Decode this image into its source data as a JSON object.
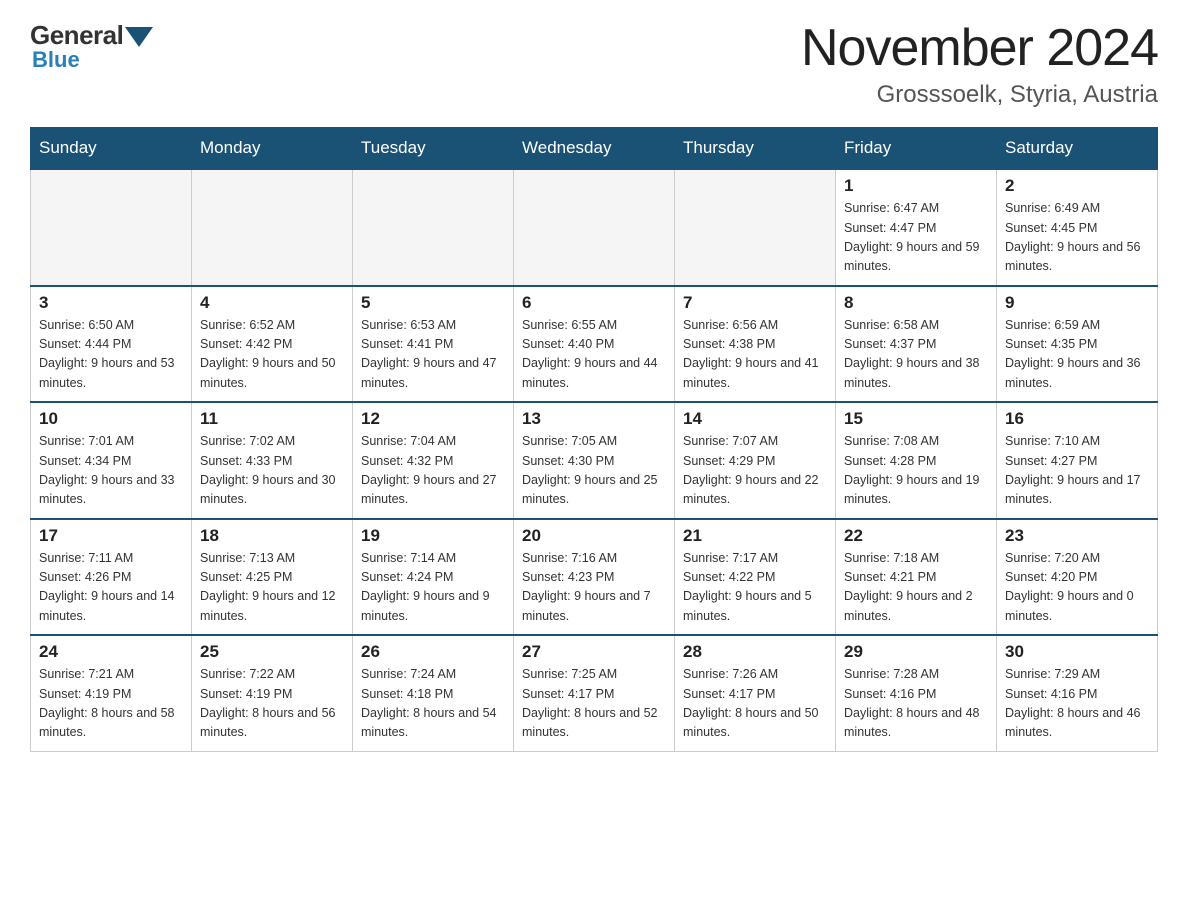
{
  "logo": {
    "text_general": "General",
    "text_blue": "Blue"
  },
  "title": "November 2024",
  "subtitle": "Grosssoelk, Styria, Austria",
  "weekdays": [
    "Sunday",
    "Monday",
    "Tuesday",
    "Wednesday",
    "Thursday",
    "Friday",
    "Saturday"
  ],
  "weeks": [
    [
      {
        "day": "",
        "sunrise": "",
        "sunset": "",
        "daylight": ""
      },
      {
        "day": "",
        "sunrise": "",
        "sunset": "",
        "daylight": ""
      },
      {
        "day": "",
        "sunrise": "",
        "sunset": "",
        "daylight": ""
      },
      {
        "day": "",
        "sunrise": "",
        "sunset": "",
        "daylight": ""
      },
      {
        "day": "",
        "sunrise": "",
        "sunset": "",
        "daylight": ""
      },
      {
        "day": "1",
        "sunrise": "Sunrise: 6:47 AM",
        "sunset": "Sunset: 4:47 PM",
        "daylight": "Daylight: 9 hours and 59 minutes."
      },
      {
        "day": "2",
        "sunrise": "Sunrise: 6:49 AM",
        "sunset": "Sunset: 4:45 PM",
        "daylight": "Daylight: 9 hours and 56 minutes."
      }
    ],
    [
      {
        "day": "3",
        "sunrise": "Sunrise: 6:50 AM",
        "sunset": "Sunset: 4:44 PM",
        "daylight": "Daylight: 9 hours and 53 minutes."
      },
      {
        "day": "4",
        "sunrise": "Sunrise: 6:52 AM",
        "sunset": "Sunset: 4:42 PM",
        "daylight": "Daylight: 9 hours and 50 minutes."
      },
      {
        "day": "5",
        "sunrise": "Sunrise: 6:53 AM",
        "sunset": "Sunset: 4:41 PM",
        "daylight": "Daylight: 9 hours and 47 minutes."
      },
      {
        "day": "6",
        "sunrise": "Sunrise: 6:55 AM",
        "sunset": "Sunset: 4:40 PM",
        "daylight": "Daylight: 9 hours and 44 minutes."
      },
      {
        "day": "7",
        "sunrise": "Sunrise: 6:56 AM",
        "sunset": "Sunset: 4:38 PM",
        "daylight": "Daylight: 9 hours and 41 minutes."
      },
      {
        "day": "8",
        "sunrise": "Sunrise: 6:58 AM",
        "sunset": "Sunset: 4:37 PM",
        "daylight": "Daylight: 9 hours and 38 minutes."
      },
      {
        "day": "9",
        "sunrise": "Sunrise: 6:59 AM",
        "sunset": "Sunset: 4:35 PM",
        "daylight": "Daylight: 9 hours and 36 minutes."
      }
    ],
    [
      {
        "day": "10",
        "sunrise": "Sunrise: 7:01 AM",
        "sunset": "Sunset: 4:34 PM",
        "daylight": "Daylight: 9 hours and 33 minutes."
      },
      {
        "day": "11",
        "sunrise": "Sunrise: 7:02 AM",
        "sunset": "Sunset: 4:33 PM",
        "daylight": "Daylight: 9 hours and 30 minutes."
      },
      {
        "day": "12",
        "sunrise": "Sunrise: 7:04 AM",
        "sunset": "Sunset: 4:32 PM",
        "daylight": "Daylight: 9 hours and 27 minutes."
      },
      {
        "day": "13",
        "sunrise": "Sunrise: 7:05 AM",
        "sunset": "Sunset: 4:30 PM",
        "daylight": "Daylight: 9 hours and 25 minutes."
      },
      {
        "day": "14",
        "sunrise": "Sunrise: 7:07 AM",
        "sunset": "Sunset: 4:29 PM",
        "daylight": "Daylight: 9 hours and 22 minutes."
      },
      {
        "day": "15",
        "sunrise": "Sunrise: 7:08 AM",
        "sunset": "Sunset: 4:28 PM",
        "daylight": "Daylight: 9 hours and 19 minutes."
      },
      {
        "day": "16",
        "sunrise": "Sunrise: 7:10 AM",
        "sunset": "Sunset: 4:27 PM",
        "daylight": "Daylight: 9 hours and 17 minutes."
      }
    ],
    [
      {
        "day": "17",
        "sunrise": "Sunrise: 7:11 AM",
        "sunset": "Sunset: 4:26 PM",
        "daylight": "Daylight: 9 hours and 14 minutes."
      },
      {
        "day": "18",
        "sunrise": "Sunrise: 7:13 AM",
        "sunset": "Sunset: 4:25 PM",
        "daylight": "Daylight: 9 hours and 12 minutes."
      },
      {
        "day": "19",
        "sunrise": "Sunrise: 7:14 AM",
        "sunset": "Sunset: 4:24 PM",
        "daylight": "Daylight: 9 hours and 9 minutes."
      },
      {
        "day": "20",
        "sunrise": "Sunrise: 7:16 AM",
        "sunset": "Sunset: 4:23 PM",
        "daylight": "Daylight: 9 hours and 7 minutes."
      },
      {
        "day": "21",
        "sunrise": "Sunrise: 7:17 AM",
        "sunset": "Sunset: 4:22 PM",
        "daylight": "Daylight: 9 hours and 5 minutes."
      },
      {
        "day": "22",
        "sunrise": "Sunrise: 7:18 AM",
        "sunset": "Sunset: 4:21 PM",
        "daylight": "Daylight: 9 hours and 2 minutes."
      },
      {
        "day": "23",
        "sunrise": "Sunrise: 7:20 AM",
        "sunset": "Sunset: 4:20 PM",
        "daylight": "Daylight: 9 hours and 0 minutes."
      }
    ],
    [
      {
        "day": "24",
        "sunrise": "Sunrise: 7:21 AM",
        "sunset": "Sunset: 4:19 PM",
        "daylight": "Daylight: 8 hours and 58 minutes."
      },
      {
        "day": "25",
        "sunrise": "Sunrise: 7:22 AM",
        "sunset": "Sunset: 4:19 PM",
        "daylight": "Daylight: 8 hours and 56 minutes."
      },
      {
        "day": "26",
        "sunrise": "Sunrise: 7:24 AM",
        "sunset": "Sunset: 4:18 PM",
        "daylight": "Daylight: 8 hours and 54 minutes."
      },
      {
        "day": "27",
        "sunrise": "Sunrise: 7:25 AM",
        "sunset": "Sunset: 4:17 PM",
        "daylight": "Daylight: 8 hours and 52 minutes."
      },
      {
        "day": "28",
        "sunrise": "Sunrise: 7:26 AM",
        "sunset": "Sunset: 4:17 PM",
        "daylight": "Daylight: 8 hours and 50 minutes."
      },
      {
        "day": "29",
        "sunrise": "Sunrise: 7:28 AM",
        "sunset": "Sunset: 4:16 PM",
        "daylight": "Daylight: 8 hours and 48 minutes."
      },
      {
        "day": "30",
        "sunrise": "Sunrise: 7:29 AM",
        "sunset": "Sunset: 4:16 PM",
        "daylight": "Daylight: 8 hours and 46 minutes."
      }
    ]
  ]
}
